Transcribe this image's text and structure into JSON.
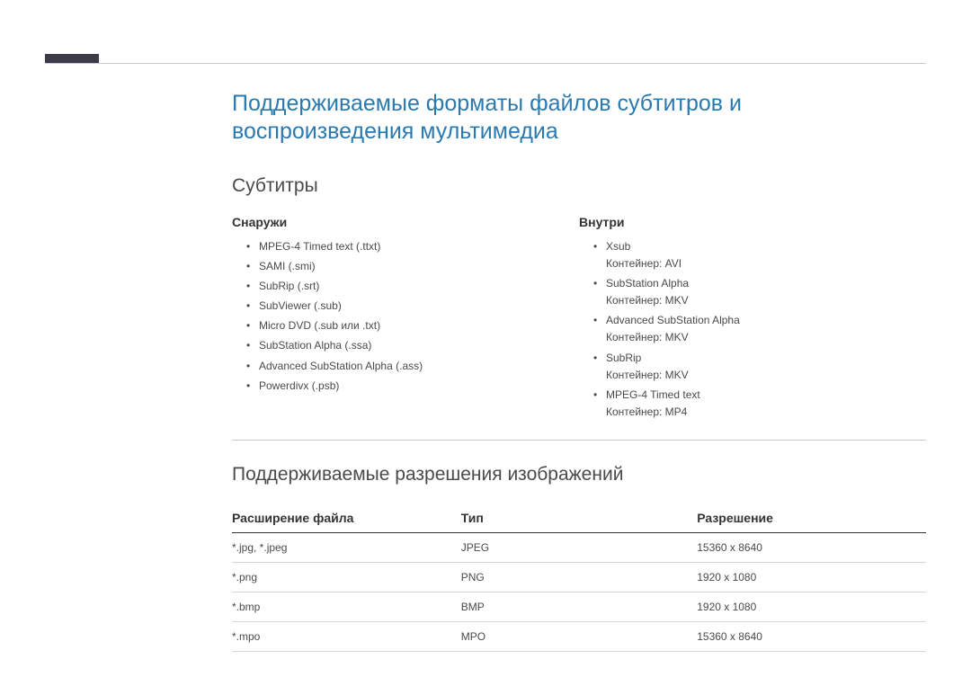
{
  "main_heading": "Поддерживаемые форматы файлов субтитров и воспроизведения мультимедиа",
  "subtitles": {
    "heading": "Субтитры",
    "external": {
      "heading": "Снаружи",
      "items": [
        {
          "label": "MPEG-4 Timed text (.ttxt)"
        },
        {
          "label": "SAMI (.smi)"
        },
        {
          "label": "SubRip (.srt)"
        },
        {
          "label": "SubViewer (.sub)"
        },
        {
          "label": "Micro DVD (.sub или .txt)"
        },
        {
          "label": "SubStation Alpha (.ssa)"
        },
        {
          "label": "Advanced SubStation Alpha (.ass)"
        },
        {
          "label": "Powerdivx (.psb)"
        }
      ]
    },
    "internal": {
      "heading": "Внутри",
      "items": [
        {
          "label": "Xsub",
          "note": "Контейнер: AVI"
        },
        {
          "label": "SubStation Alpha",
          "note": "Контейнер: MKV"
        },
        {
          "label": "Advanced SubStation Alpha",
          "note": "Контейнер: MKV"
        },
        {
          "label": "SubRip",
          "note": "Контейнер: MKV"
        },
        {
          "label": "MPEG-4 Timed text",
          "note": "Контейнер: MP4"
        }
      ]
    }
  },
  "images": {
    "heading": "Поддерживаемые разрешения изображений",
    "columns": {
      "ext": "Расширение файла",
      "type": "Тип",
      "res": "Разрешение"
    },
    "rows": [
      {
        "ext": "*.jpg, *.jpeg",
        "type": "JPEG",
        "res": "15360 x 8640"
      },
      {
        "ext": "*.png",
        "type": "PNG",
        "res": "1920 x 1080"
      },
      {
        "ext": "*.bmp",
        "type": "BMP",
        "res": "1920 x 1080"
      },
      {
        "ext": "*.mpo",
        "type": "MPO",
        "res": "15360 x 8640"
      }
    ]
  }
}
